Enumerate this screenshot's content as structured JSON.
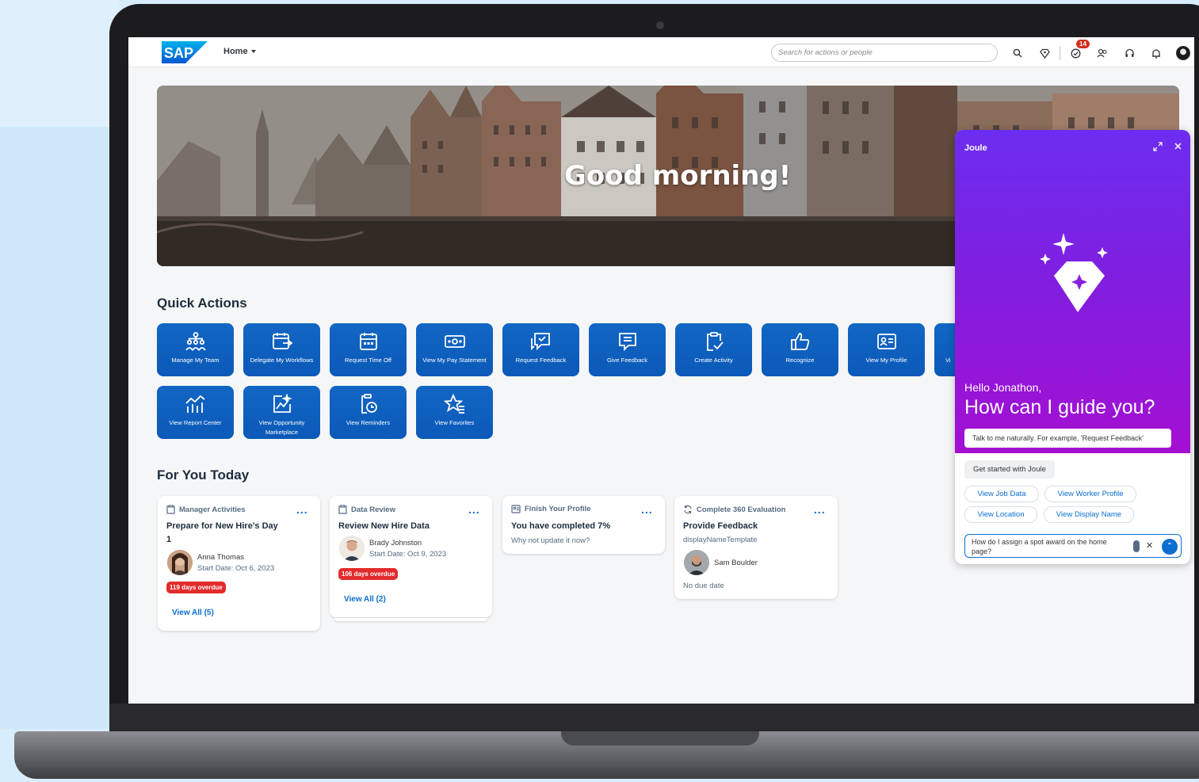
{
  "header": {
    "logo_text": "SAP",
    "home_label": "Home",
    "search_placeholder": "Search for actions or people",
    "notification_count": "14",
    "icons": [
      "search-icon",
      "diamond-icon",
      "tasks-icon",
      "people-icon",
      "headset-icon",
      "bell-icon",
      "avatar"
    ]
  },
  "banner": {
    "greeting": "Good morning!"
  },
  "quick_actions": {
    "title": "Quick Actions",
    "items": [
      {
        "label": "Manage My Team",
        "icon": "org-chart-icon"
      },
      {
        "label": "Delegate My Workflows",
        "icon": "calendar-forward-icon"
      },
      {
        "label": "Request Time Off",
        "icon": "calendar-icon"
      },
      {
        "label": "View My Pay Statement",
        "icon": "money-icon"
      },
      {
        "label": "Request Feedback",
        "icon": "feedback-request-icon"
      },
      {
        "label": "Give Feedback",
        "icon": "feedback-icon"
      },
      {
        "label": "Create Activity",
        "icon": "clipboard-check-icon"
      },
      {
        "label": "Recognize",
        "icon": "thumbs-up-icon"
      },
      {
        "label": "View My Profile",
        "icon": "profile-card-icon"
      },
      {
        "label": "Vi",
        "icon": "partial-tile"
      },
      {
        "label": "View Report Center",
        "icon": "report-chart-icon"
      },
      {
        "label": "View Opportunity Marketplace",
        "icon": "opportunity-icon"
      },
      {
        "label": "View Reminders",
        "icon": "reminder-icon"
      },
      {
        "label": "View Favorites",
        "icon": "star-list-icon"
      }
    ]
  },
  "for_you_today": {
    "title": "For You Today",
    "cards": [
      {
        "category": "Manager Activities",
        "title_line1": "Prepare for New Hire's Day",
        "title_line2": "1",
        "person": "Anna Thomas",
        "start_date": "Start Date: Oct 6, 2023",
        "overdue": "119 days overdue",
        "view_all": "View All (5)"
      },
      {
        "category": "Data Review",
        "title_line1": "Review New Hire Data",
        "person": "Brady Johnston",
        "start_date": "Start Date: Oct 9, 2023",
        "overdue": "106 days overdue",
        "view_all": "View All (2)"
      },
      {
        "category": "Finish Your Profile",
        "title_line1": "You have completed 7%",
        "subtitle": "Why not update it now?"
      },
      {
        "category": "Complete 360 Evaluation",
        "title_line1": "Provide Feedback",
        "subtitle": "displayNameTemplate",
        "person": "Sam Boulder",
        "due": "No due date"
      }
    ]
  },
  "joule": {
    "title": "Joule",
    "hello": "Hello Jonathon,",
    "headline": "How can I guide you?",
    "prompt_hint": "Talk to me naturally. For example, 'Request Feedback'",
    "get_started": "Get started with Joule",
    "suggestions": [
      "View Job Data",
      "View Worker Profile",
      "View Location",
      "View Display Name"
    ],
    "input_value": "How do I assign a spot award on the home page?"
  },
  "colors": {
    "tile_blue": "#0b59b8",
    "joule_purple": "#7f1fe0",
    "overdue_red": "#e32b2b",
    "link_blue": "#0a6ed1"
  }
}
